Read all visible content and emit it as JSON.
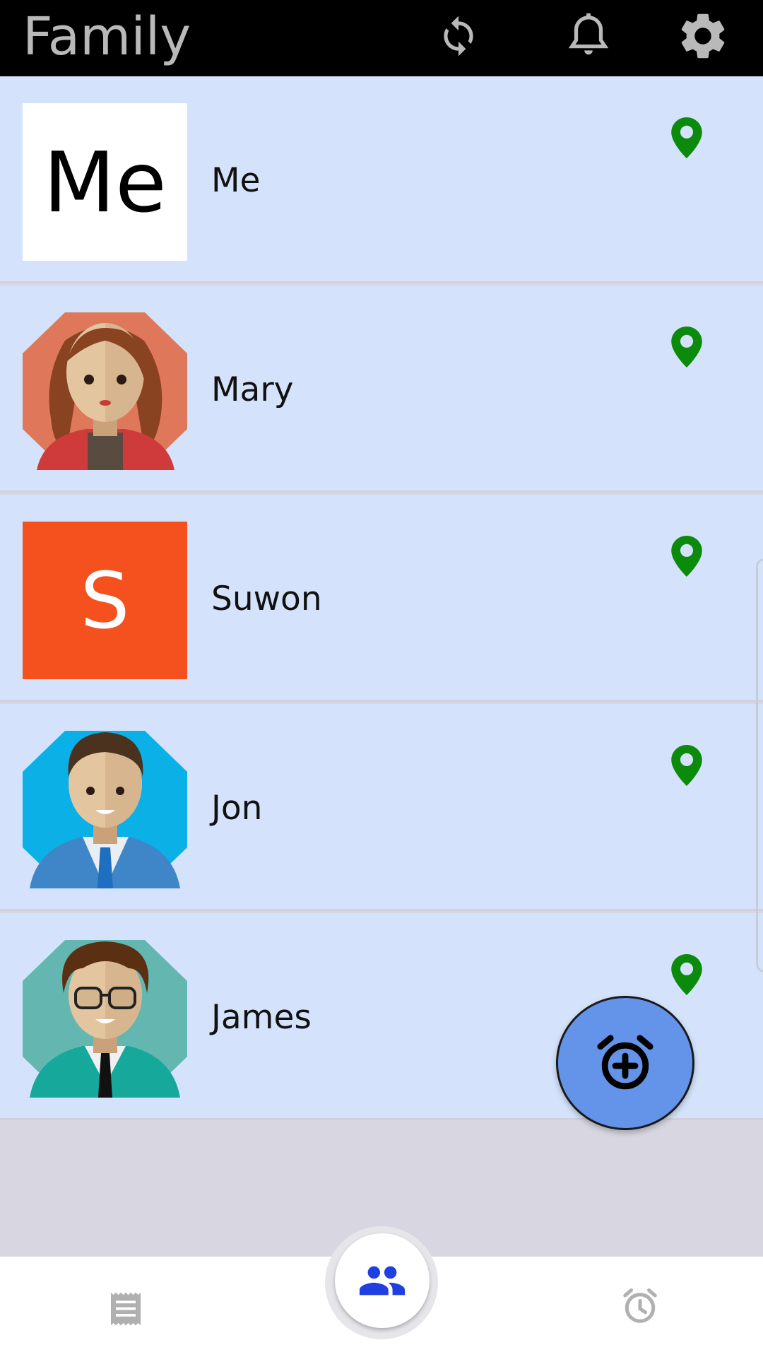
{
  "header": {
    "title": "Family",
    "actions": [
      "refresh-icon",
      "bell-icon",
      "gear-icon"
    ]
  },
  "members": [
    {
      "name": "Me",
      "avatar_text": "Me",
      "avatar_type": "text"
    },
    {
      "name": "Mary",
      "avatar_type": "illustration"
    },
    {
      "name": "Suwon",
      "avatar_text": "S",
      "avatar_type": "text"
    },
    {
      "name": "Jon",
      "avatar_type": "illustration"
    },
    {
      "name": "James",
      "avatar_type": "illustration"
    }
  ],
  "fab": {
    "icon": "add-alarm-icon"
  },
  "bottom_nav": {
    "items": [
      "receipt-icon",
      "people-icon",
      "alarm-icon"
    ],
    "active": "people-icon"
  },
  "colors": {
    "header_bg": "#000000",
    "row_bg": "#d4e3fb",
    "pin": "#0b8a0b",
    "fab": "#6494ea",
    "active_nav": "#1f3fe0",
    "suwon_avatar": "#f4511e"
  }
}
